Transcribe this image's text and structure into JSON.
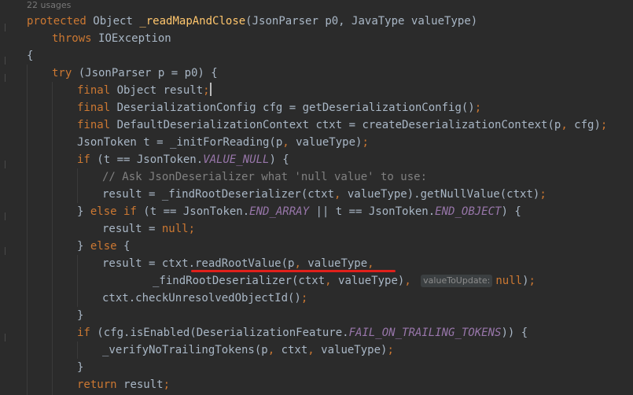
{
  "editor": {
    "usages_label": "22 usages",
    "annotation_color": "#e0201b",
    "lines": [
      {
        "indent": 0,
        "tokens": [
          {
            "t": "protected ",
            "c": "k"
          },
          {
            "t": "Object ",
            "c": "p"
          },
          {
            "t": "_readMapAndClose",
            "c": "f"
          },
          {
            "t": "(JsonParser p0, JavaType valueType)",
            "c": "p"
          }
        ]
      },
      {
        "indent": 1,
        "tokens": [
          {
            "t": "throws ",
            "c": "k"
          },
          {
            "t": "IOException",
            "c": "p"
          }
        ]
      },
      {
        "indent": 0,
        "tokens": [
          {
            "t": "{",
            "c": "p"
          }
        ]
      },
      {
        "indent": 1,
        "tokens": [
          {
            "t": "try ",
            "c": "k"
          },
          {
            "t": "(JsonParser p = p0) {",
            "c": "p"
          }
        ]
      },
      {
        "indent": 2,
        "tokens": [
          {
            "t": "final ",
            "c": "k"
          },
          {
            "t": "Object result",
            "c": "p"
          },
          {
            "t": ";",
            "c": "k"
          }
        ],
        "caret": true
      },
      {
        "indent": 2,
        "tokens": [
          {
            "t": "final ",
            "c": "k"
          },
          {
            "t": "DeserializationConfig cfg = getDeserializationConfig()",
            "c": "p"
          },
          {
            "t": ";",
            "c": "k"
          }
        ]
      },
      {
        "indent": 2,
        "tokens": [
          {
            "t": "final ",
            "c": "k"
          },
          {
            "t": "DefaultDeserializationContext ctxt = createDeserializationContext(p",
            "c": "p"
          },
          {
            "t": ", ",
            "c": "k"
          },
          {
            "t": "cfg)",
            "c": "p"
          },
          {
            "t": ";",
            "c": "k"
          }
        ]
      },
      {
        "indent": 2,
        "tokens": [
          {
            "t": "JsonToken t = _initForReading(p",
            "c": "p"
          },
          {
            "t": ", ",
            "c": "k"
          },
          {
            "t": "valueType)",
            "c": "p"
          },
          {
            "t": ";",
            "c": "k"
          }
        ]
      },
      {
        "indent": 2,
        "tokens": [
          {
            "t": "if ",
            "c": "k"
          },
          {
            "t": "(t == JsonToken.",
            "c": "p"
          },
          {
            "t": "VALUE_NULL",
            "c": "st"
          },
          {
            "t": ") {",
            "c": "p"
          }
        ]
      },
      {
        "indent": 3,
        "tokens": [
          {
            "t": "// Ask JsonDeserializer what 'null value' to use:",
            "c": "c"
          }
        ]
      },
      {
        "indent": 3,
        "tokens": [
          {
            "t": "result = _findRootDeserializer(ctxt",
            "c": "p"
          },
          {
            "t": ", ",
            "c": "k"
          },
          {
            "t": "valueType).getNullValue(ctxt)",
            "c": "p"
          },
          {
            "t": ";",
            "c": "k"
          }
        ]
      },
      {
        "indent": 2,
        "tokens": [
          {
            "t": "} ",
            "c": "p"
          },
          {
            "t": "else if ",
            "c": "k"
          },
          {
            "t": "(t == JsonToken.",
            "c": "p"
          },
          {
            "t": "END_ARRAY",
            "c": "st"
          },
          {
            "t": " || t == JsonToken.",
            "c": "p"
          },
          {
            "t": "END_OBJECT",
            "c": "st"
          },
          {
            "t": ") {",
            "c": "p"
          }
        ]
      },
      {
        "indent": 3,
        "tokens": [
          {
            "t": "result = ",
            "c": "p"
          },
          {
            "t": "null",
            "c": "k"
          },
          {
            "t": ";",
            "c": "k"
          }
        ]
      },
      {
        "indent": 2,
        "tokens": [
          {
            "t": "} ",
            "c": "p"
          },
          {
            "t": "else ",
            "c": "k"
          },
          {
            "t": "{",
            "c": "p"
          }
        ]
      },
      {
        "indent": 3,
        "tokens": [
          {
            "t": "result = ctxt.readRootValue(p",
            "c": "p"
          },
          {
            "t": ", ",
            "c": "k"
          },
          {
            "t": "valueType",
            "c": "p"
          },
          {
            "t": ",",
            "c": "k"
          }
        ]
      },
      {
        "indent": 5,
        "tokens": [
          {
            "t": "_findRootDeserializer(ctxt",
            "c": "p"
          },
          {
            "t": ", ",
            "c": "k"
          },
          {
            "t": "valueType)",
            "c": "p"
          },
          {
            "t": ", ",
            "c": "k"
          },
          {
            "hint": "valueToUpdate:"
          },
          {
            "t": "null",
            "c": "k"
          },
          {
            "t": ")",
            "c": "p"
          },
          {
            "t": ";",
            "c": "k"
          }
        ]
      },
      {
        "indent": 3,
        "tokens": [
          {
            "t": "ctxt.checkUnresolvedObjectId()",
            "c": "p"
          },
          {
            "t": ";",
            "c": "k"
          }
        ]
      },
      {
        "indent": 2,
        "tokens": [
          {
            "t": "}",
            "c": "p"
          }
        ]
      },
      {
        "indent": 2,
        "tokens": [
          {
            "t": "if ",
            "c": "k"
          },
          {
            "t": "(cfg.isEnabled(DeserializationFeature.",
            "c": "p"
          },
          {
            "t": "FAIL_ON_TRAILING_TOKENS",
            "c": "st"
          },
          {
            "t": ")) {",
            "c": "p"
          }
        ]
      },
      {
        "indent": 3,
        "tokens": [
          {
            "t": "_verifyNoTrailingTokens(p",
            "c": "p"
          },
          {
            "t": ", ",
            "c": "k"
          },
          {
            "t": "ctxt",
            "c": "p"
          },
          {
            "t": ", ",
            "c": "k"
          },
          {
            "t": "valueType)",
            "c": "p"
          },
          {
            "t": ";",
            "c": "k"
          }
        ]
      },
      {
        "indent": 2,
        "tokens": [
          {
            "t": "}",
            "c": "p"
          }
        ]
      },
      {
        "indent": 2,
        "tokens": [
          {
            "t": "return ",
            "c": "k"
          },
          {
            "t": "result",
            "c": "p"
          },
          {
            "t": ";",
            "c": "k"
          }
        ]
      }
    ]
  }
}
